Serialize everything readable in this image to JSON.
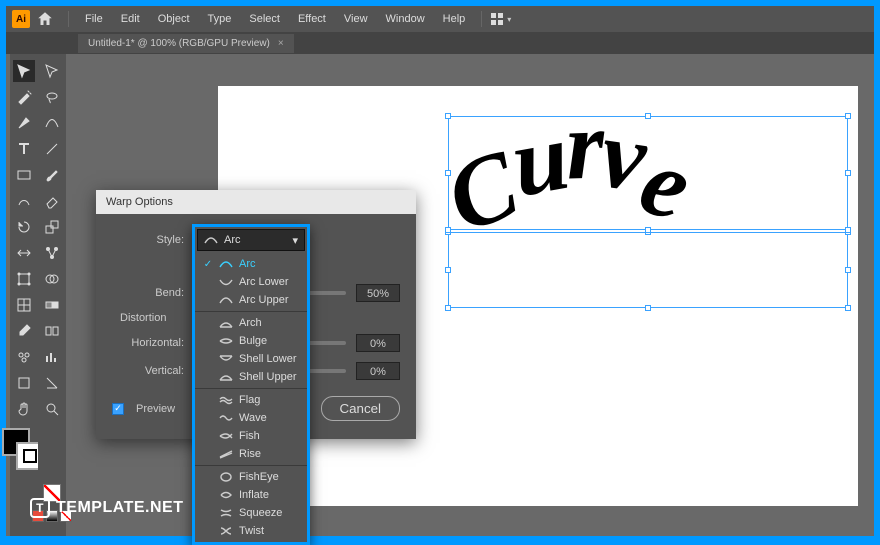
{
  "app_icon_text": "Ai",
  "menubar": {
    "items": [
      "File",
      "Edit",
      "Object",
      "Type",
      "Select",
      "Effect",
      "View",
      "Window",
      "Help"
    ]
  },
  "tab": {
    "label": "Untitled-1* @ 100% (RGB/GPU Preview)"
  },
  "artwork_text": "Curve",
  "dialog": {
    "title": "Warp Options",
    "style_label": "Style:",
    "style_value": "Arc",
    "bend_label": "Bend:",
    "bend_value": "50%",
    "distortion_label": "Distortion",
    "horizontal_label": "Horizontal:",
    "horizontal_value": "0%",
    "vertical_label": "Vertical:",
    "vertical_value": "0%",
    "preview_label": "Preview",
    "cancel_label": "Cancel"
  },
  "dropdown": {
    "head": "Arc",
    "groups": [
      [
        "Arc",
        "Arc Lower",
        "Arc Upper"
      ],
      [
        "Arch",
        "Bulge",
        "Shell Lower",
        "Shell Upper"
      ],
      [
        "Flag",
        "Wave",
        "Fish",
        "Rise"
      ],
      [
        "FishEye",
        "Inflate",
        "Squeeze",
        "Twist"
      ]
    ],
    "selected": "Arc"
  },
  "watermark": "TEMPLATE.NET"
}
